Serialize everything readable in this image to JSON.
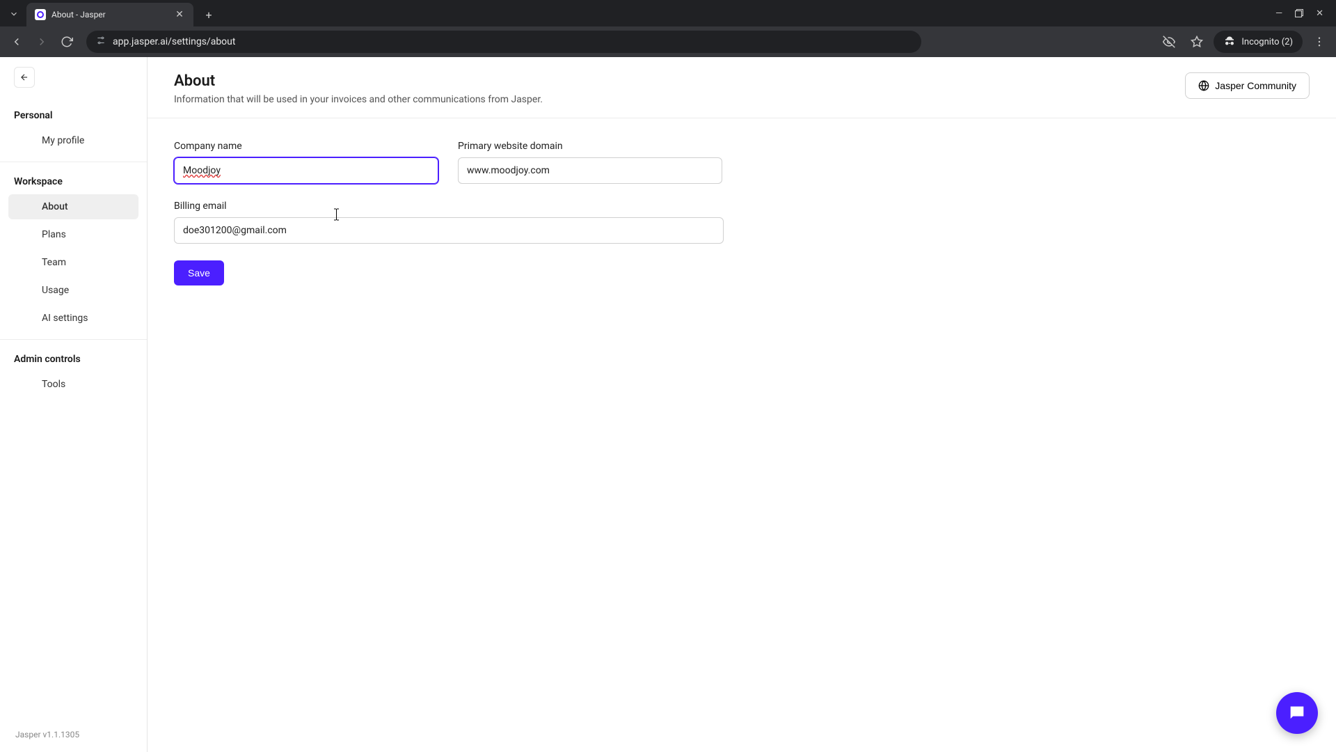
{
  "browser": {
    "tab_title": "About - Jasper",
    "url": "app.jasper.ai/settings/about",
    "incognito_label": "Incognito (2)"
  },
  "sidebar": {
    "sections": {
      "personal": {
        "label": "Personal",
        "items": [
          {
            "label": "My profile"
          }
        ]
      },
      "workspace": {
        "label": "Workspace",
        "items": [
          {
            "label": "About",
            "active": true
          },
          {
            "label": "Plans"
          },
          {
            "label": "Team"
          },
          {
            "label": "Usage"
          },
          {
            "label": "AI settings"
          }
        ]
      },
      "admin": {
        "label": "Admin controls",
        "items": [
          {
            "label": "Tools"
          }
        ]
      }
    },
    "footer": "Jasper v1.1.1305"
  },
  "header": {
    "title": "About",
    "subtitle": "Information that will be used in your invoices and other communications from Jasper.",
    "community_button": "Jasper Community"
  },
  "form": {
    "company_name": {
      "label": "Company name",
      "value": "Moodjoy"
    },
    "primary_domain": {
      "label": "Primary website domain",
      "value": "www.moodjoy.com"
    },
    "billing_email": {
      "label": "Billing email",
      "value": "doe301200@gmail.com"
    },
    "save_label": "Save"
  }
}
